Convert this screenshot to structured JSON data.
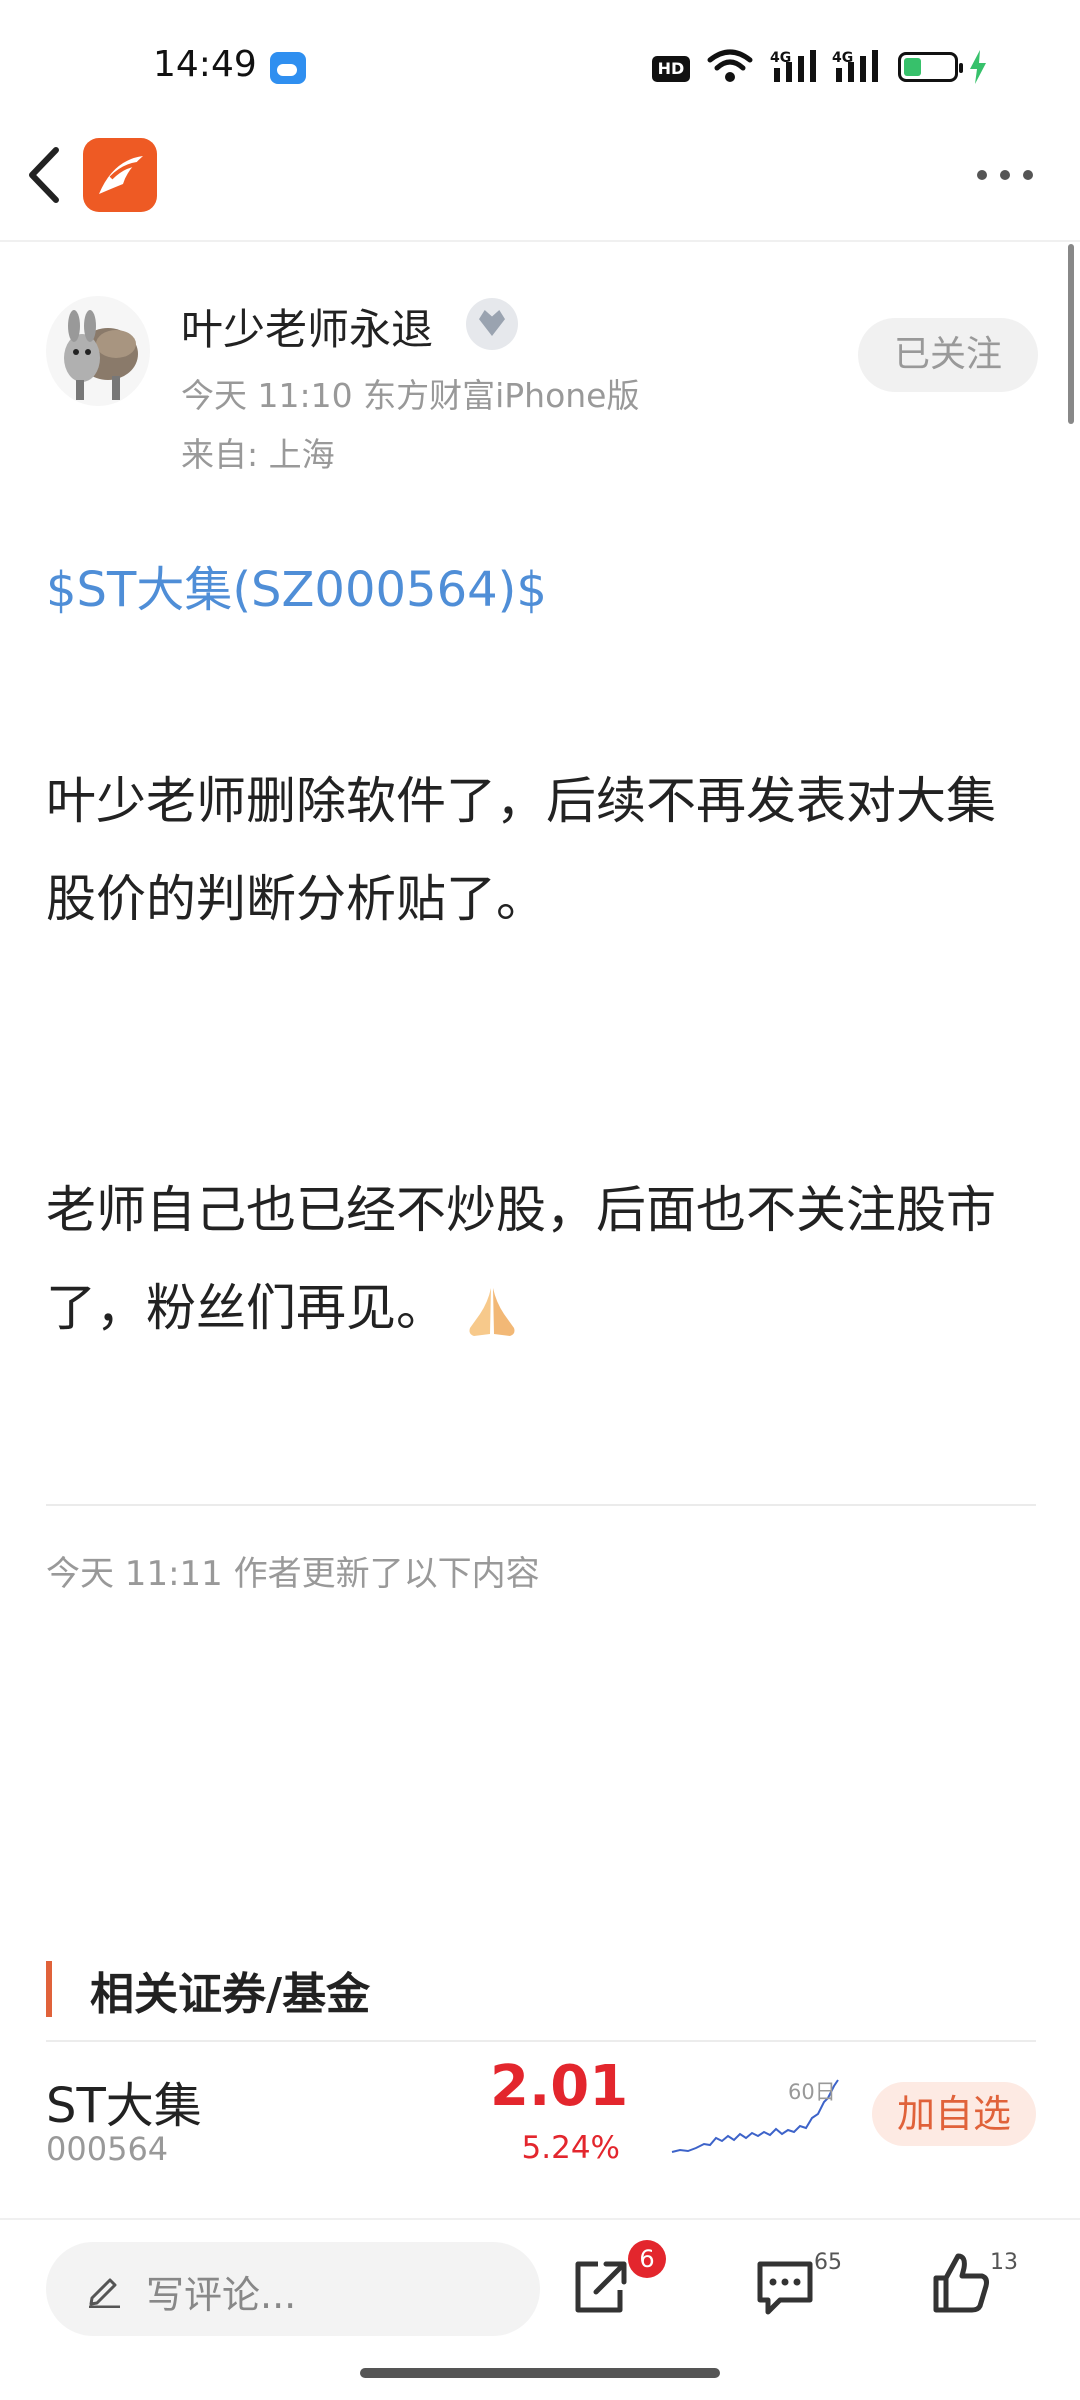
{
  "status_bar": {
    "time": "14:49",
    "hd_label": "HD",
    "network_1": "4G",
    "network_2": "4G"
  },
  "author": {
    "name": "叶少老师永退",
    "meta": "今天 11:10 东方财富iPhone版",
    "location": "来自: 上海",
    "follow_label": "已关注"
  },
  "post": {
    "stock_tag": "$ST大集(SZ000564)$",
    "paragraph_1": "叶少老师删除软件了，后续不再发表对大集股价的判断分析贴了。",
    "paragraph_2": "老师自己也已经不炒股，后面也不关注股市了，粉丝们再见。",
    "update_note": "今天 11:11  作者更新了以下内容"
  },
  "related": {
    "title": "相关证券/基金",
    "security": {
      "name": "ST大集",
      "code": "000564",
      "price": "2.01",
      "change": "5.24%",
      "chart_label": "60日",
      "add_label": "加自选",
      "price_color": "#e3262d"
    }
  },
  "bottom_bar": {
    "comment_placeholder": "写评论...",
    "share_badge": "6",
    "comment_count": "65",
    "like_count": "13"
  },
  "colors": {
    "accent": "#ee5a24",
    "link": "#4f8ed7",
    "up": "#e3262d"
  }
}
